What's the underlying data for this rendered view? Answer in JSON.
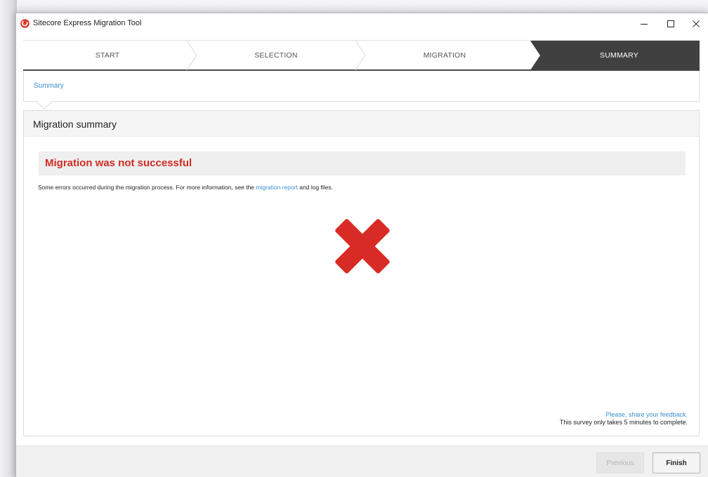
{
  "window": {
    "title": "Sitecore Express Migration Tool"
  },
  "wizard": {
    "steps": [
      {
        "label": "START",
        "state": "done"
      },
      {
        "label": "SELECTION",
        "state": "done"
      },
      {
        "label": "MIGRATION",
        "state": "done"
      },
      {
        "label": "SUMMARY",
        "state": "active"
      }
    ]
  },
  "breadcrumb": {
    "current": "Summary"
  },
  "panel": {
    "title": "Migration summary",
    "error_title": "Migration was not successful",
    "error_desc_prefix": "Some errors occurred during the migration process. For more information, see the ",
    "error_desc_link": "migration report",
    "error_desc_suffix": " and log files.",
    "status_icon": "error-x-icon"
  },
  "feedback": {
    "link": "Please, share your feedback.",
    "note": "This survey only takes 5 minutes to complete."
  },
  "footer": {
    "previous_label": "Previous",
    "finish_label": "Finish"
  },
  "colors": {
    "accent": "#3a8fd0",
    "error": "#d12c24",
    "active_step": "#404040"
  }
}
